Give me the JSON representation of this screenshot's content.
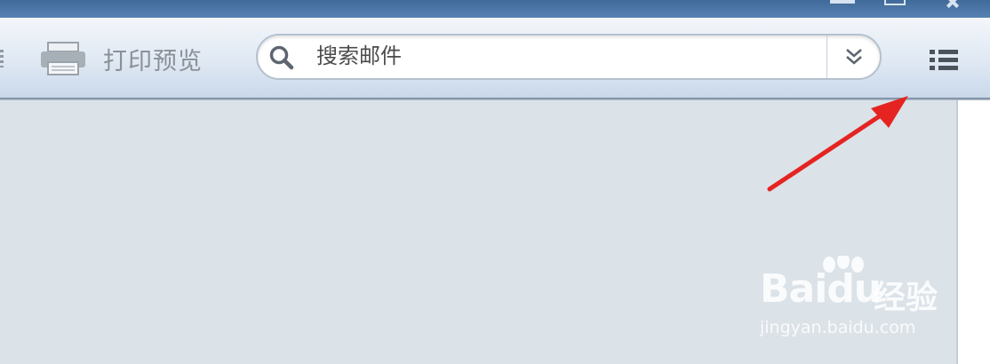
{
  "window": {
    "controls": [
      "minimize-icon",
      "maximize-icon",
      "close-icon"
    ]
  },
  "toolbar": {
    "print_preview_label": "打印预览",
    "print_icon": "printer-icon",
    "search": {
      "placeholder": "搜索邮件",
      "value": "",
      "icon": "search-icon",
      "dropdown_icon": "double-chevron-down-icon"
    },
    "menu_icon": "list-menu-icon"
  },
  "annotation": {
    "arrow_color": "#e52421"
  },
  "watermark": {
    "brand": "Bai",
    "brand_suffix": "du",
    "brand_cn": "经验",
    "url": "jingyan.baidu.com"
  },
  "colors": {
    "titlebar": "#4a75a5",
    "toolbar": "#dfe8f3",
    "content_bg": "#dbe2e8",
    "label_gray": "#8b9097"
  }
}
